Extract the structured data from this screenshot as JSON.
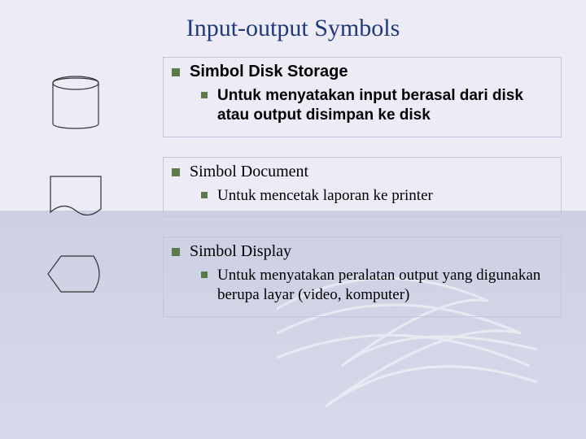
{
  "title": "Input-output Symbols",
  "items": [
    {
      "heading": "Simbol Disk Storage",
      "desc": "Untuk  menyatakan input berasal dari disk atau output disimpan ke disk"
    },
    {
      "heading": "Simbol Document",
      "desc": "Untuk mencetak laporan ke printer"
    },
    {
      "heading": "Simbol Display",
      "desc": "Untuk menyatakan peralatan output yang digunakan berupa layar (video, komputer)"
    }
  ]
}
